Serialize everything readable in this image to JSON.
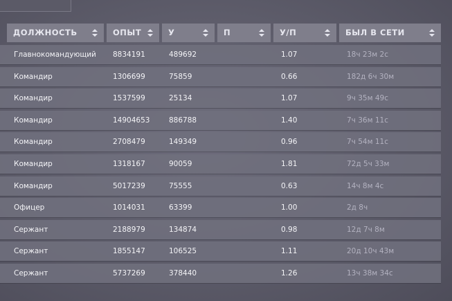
{
  "table": {
    "columns": [
      {
        "key": "rank",
        "label": "ДОЛЖНОСТЬ"
      },
      {
        "key": "exp",
        "label": "ОПЫТ"
      },
      {
        "key": "kills",
        "label": "У"
      },
      {
        "key": "deaths",
        "label": "П"
      },
      {
        "key": "kd",
        "label": "У/П"
      },
      {
        "key": "last_seen",
        "label": "БЫЛ В СЕТИ"
      }
    ],
    "rows": [
      {
        "rank": "Главнокомандующий",
        "exp": "8834191",
        "kills": "489692",
        "deaths": "",
        "kd": "1.07",
        "last_seen": "18ч 23м 2с"
      },
      {
        "rank": "Командир",
        "exp": "1306699",
        "kills": "75859",
        "deaths": "",
        "kd": "0.66",
        "last_seen": "182д 6ч 30м"
      },
      {
        "rank": "Командир",
        "exp": "1537599",
        "kills": "25134",
        "deaths": "",
        "kd": "1.07",
        "last_seen": "9ч 35м 49с"
      },
      {
        "rank": "Командир",
        "exp": "14904653",
        "kills": "886788",
        "deaths": "",
        "kd": "1.40",
        "last_seen": "7ч 36м 11с"
      },
      {
        "rank": "Командир",
        "exp": "2708479",
        "kills": "149349",
        "deaths": "",
        "kd": "0.96",
        "last_seen": "7ч 54м 11с"
      },
      {
        "rank": "Командир",
        "exp": "1318167",
        "kills": "90059",
        "deaths": "",
        "kd": "1.81",
        "last_seen": "72д 5ч 33м"
      },
      {
        "rank": "Командир",
        "exp": "5017239",
        "kills": "75555",
        "deaths": "",
        "kd": "0.63",
        "last_seen": "14ч 8м 4с"
      },
      {
        "rank": "Офицер",
        "exp": "1014031",
        "kills": "63399",
        "deaths": "",
        "kd": "1.00",
        "last_seen": "2д 8ч"
      },
      {
        "rank": "Сержант",
        "exp": "2188979",
        "kills": "134874",
        "deaths": "",
        "kd": "0.98",
        "last_seen": "12д 7ч 8м"
      },
      {
        "rank": "Сержант",
        "exp": "1855147",
        "kills": "106525",
        "deaths": "",
        "kd": "1.11",
        "last_seen": "20д 10ч 43м"
      },
      {
        "rank": "Сержант",
        "exp": "5737269",
        "kills": "378440",
        "deaths": "",
        "kd": "1.26",
        "last_seen": "13ч 38м 34с"
      }
    ]
  },
  "icons": {
    "sort": "sort-updown-icon"
  },
  "colors": {
    "header_bg": "#7f7e8b",
    "row_bg": "#706f7d",
    "text": "#f4f4f7",
    "muted_text": "#b3b2c0"
  }
}
